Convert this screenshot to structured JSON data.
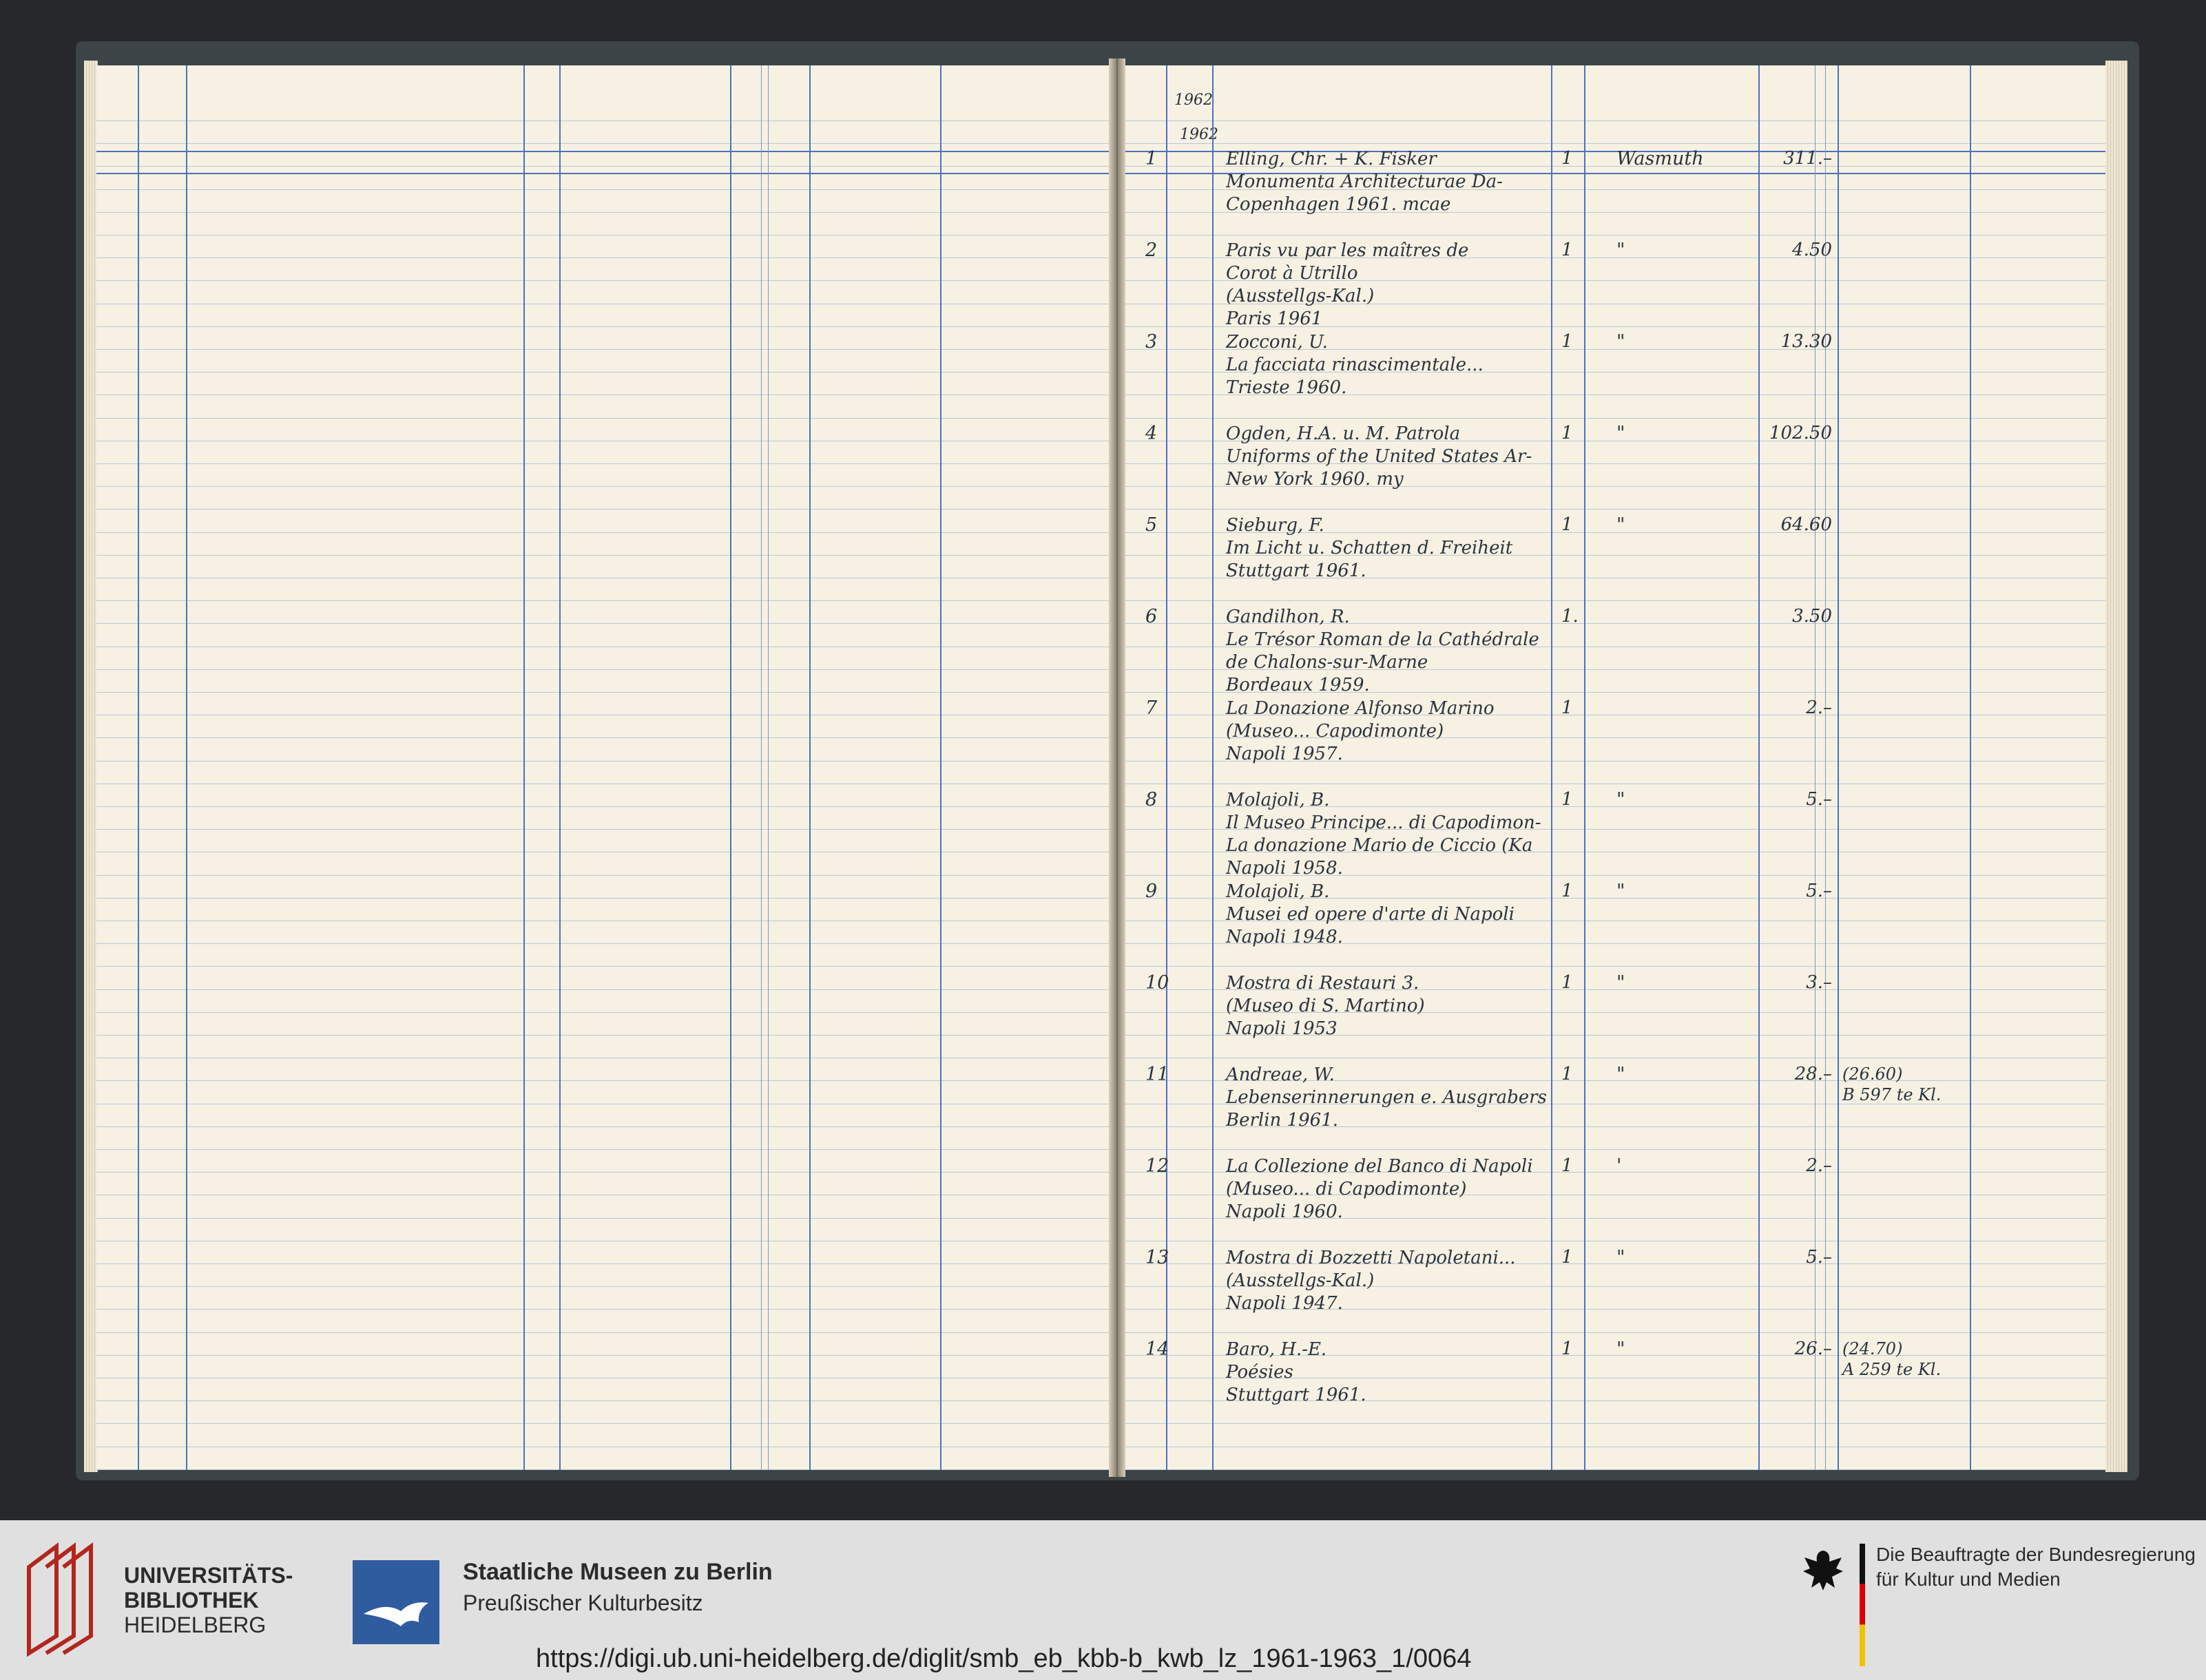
{
  "ledger": {
    "year_top": "1962",
    "year_sub": "1962",
    "rows": [
      {
        "no": "1",
        "lines": [
          "Elling, Chr. + K. Fisker",
          "Monumenta Architecturae Da-",
          "Copenhagen 1961.        mcae"
        ],
        "qty": "1",
        "dealer": "Wasmuth",
        "price": "311.–",
        "note": []
      },
      {
        "no": "2",
        "lines": [
          "Paris vu par les maîtres de",
          "Corot à Utrillo",
          "(Ausstellgs-Kal.)",
          "Paris 1961"
        ],
        "qty": "1",
        "dealer": "\"",
        "price": "4.50",
        "note": []
      },
      {
        "no": "3",
        "lines": [
          "Zocconi, U.",
          "La facciata rinascimentale...",
          "Trieste 1960."
        ],
        "qty": "1",
        "dealer": "\"",
        "price": "13.30",
        "note": []
      },
      {
        "no": "4",
        "lines": [
          "Ogden, H.A. u. M. Patrola",
          "Uniforms of the United States Ar-",
          "New York 1960.         my"
        ],
        "qty": "1",
        "dealer": "\"",
        "price": "102.50",
        "note": []
      },
      {
        "no": "5",
        "lines": [
          "Sieburg, F.",
          "Im Licht u. Schatten d. Freiheit",
          "Stuttgart 1961."
        ],
        "qty": "1",
        "dealer": "\"",
        "price": "64.60",
        "note": []
      },
      {
        "no": "6",
        "lines": [
          "Gandilhon, R.",
          "Le Trésor Roman de la Cathédrale",
          "de Chalons-sur-Marne",
          "Bordeaux 1959."
        ],
        "qty": "1.",
        "dealer": "",
        "price": "3.50",
        "note": []
      },
      {
        "no": "7",
        "lines": [
          "La Donazione Alfonso Marino",
          "(Museo... Capodimonte)",
          "Napoli 1957."
        ],
        "qty": "1",
        "dealer": "",
        "price": "2.–",
        "note": []
      },
      {
        "no": "8",
        "lines": [
          "Molajoli, B.",
          "Il Museo Principe... di Capodimon-",
          "La donazione Mario de Ciccio (Ka",
          "Napoli 1958."
        ],
        "qty": "1",
        "dealer": "\"",
        "price": "5.–",
        "note": []
      },
      {
        "no": "9",
        "lines": [
          "Molajoli, B.",
          "Musei ed opere d'arte di Napoli",
          "Napoli 1948."
        ],
        "qty": "1",
        "dealer": "\"",
        "price": "5.–",
        "note": []
      },
      {
        "no": "10",
        "lines": [
          "Mostra di Restauri 3.",
          "(Museo di S. Martino)",
          "Napoli 1953"
        ],
        "qty": "1",
        "dealer": "\"",
        "price": "3.–",
        "note": []
      },
      {
        "no": "11",
        "lines": [
          "Andreae, W.",
          "Lebenserinnerungen e. Ausgrabers",
          "Berlin 1961."
        ],
        "qty": "1",
        "dealer": "\"",
        "price": "28.–",
        "note": [
          "(26.60)",
          "B 597 te Kl."
        ]
      },
      {
        "no": "12",
        "lines": [
          "La Collezione del Banco di Napoli",
          "(Museo... di Capodimonte)",
          "Napoli 1960."
        ],
        "qty": "1",
        "dealer": "'",
        "price": "2.–",
        "note": []
      },
      {
        "no": "13",
        "lines": [
          "Mostra di Bozzetti Napoletani...",
          "(Ausstellgs-Kal.)",
          "Napoli 1947."
        ],
        "qty": "1",
        "dealer": "\"",
        "price": "5.–",
        "note": []
      },
      {
        "no": "14",
        "lines": [
          "Baro, H.-E.",
          "Poésies",
          "Stuttgart 1961."
        ],
        "qty": "1",
        "dealer": "\"",
        "price": "26.–",
        "note": [
          "(24.70)",
          "A 259 te Kl."
        ]
      }
    ]
  },
  "footer": {
    "ub_line1": "UNIVERSITÄTS-",
    "ub_line2": "BIBLIOTHEK",
    "ub_line3": "HEIDELBERG",
    "smb_line1": "Staatliche Museen zu Berlin",
    "smb_line2": "Preußischer Kulturbesitz",
    "bkm_line1": "Die Beauftragte der Bundesregierung",
    "bkm_line2": "für Kultur und Medien",
    "url": "https://digi.ub.uni-heidelberg.de/diglit/smb_eb_kbb-b_kwb_lz_1961-1963_1/0064"
  },
  "colors": {
    "ruling": "#4d72b8",
    "paper": "#f6f1e2",
    "cover": "#3c4447",
    "ub_red": "#b3261e",
    "smb_blue": "#2f5c9e",
    "flag_gold": "#f2c200",
    "flag_red": "#dd0000"
  },
  "icons": [
    "ub-heidelberg-logo-icon",
    "smb-eagle-logo-icon",
    "federal-eagle-icon"
  ]
}
